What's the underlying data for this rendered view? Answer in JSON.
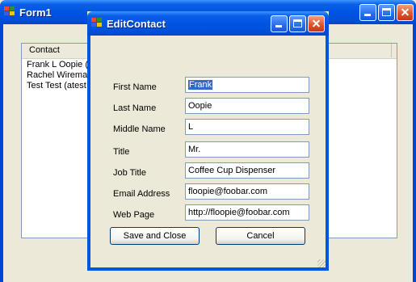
{
  "main_window": {
    "title": "Form1",
    "list": {
      "column_header": "Contact",
      "rows": [
        "Frank L Oopie (f",
        "Rachel Wireman",
        "Test Test (atest"
      ]
    }
  },
  "dialog": {
    "title": "EditContact",
    "fields": [
      {
        "label": "First Name",
        "value": "Frank"
      },
      {
        "label": "Last Name",
        "value": "Oopie"
      },
      {
        "label": "Middle Name",
        "value": "L"
      },
      {
        "label": "Title",
        "value": "Mr."
      },
      {
        "label": "Job Title",
        "value": "Coffee Cup Dispenser"
      },
      {
        "label": "Email Address",
        "value": "floopie@foobar.com"
      },
      {
        "label": "Web Page",
        "value": "http://floopie@foobar.com"
      }
    ],
    "buttons": {
      "save": "Save and Close",
      "cancel": "Cancel"
    }
  },
  "colors": {
    "titlebar": "#0054e3",
    "selection": "#316ac5",
    "face": "#ece9d8",
    "close_button": "#e0552e"
  },
  "icons": [
    "app-icon",
    "minimize-icon",
    "maximize-icon",
    "close-icon",
    "resize-grip-icon"
  ]
}
